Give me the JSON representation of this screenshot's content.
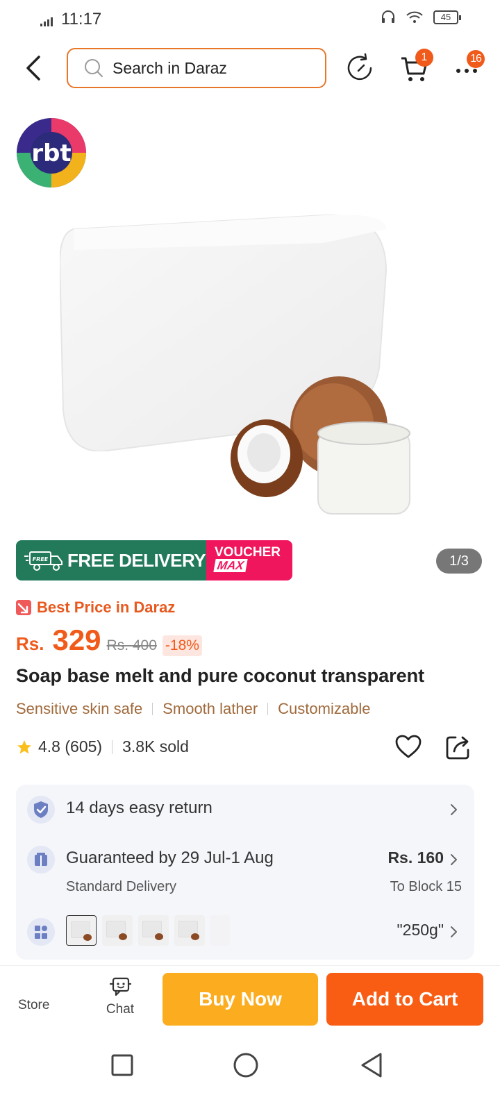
{
  "status_bar": {
    "time": "11:17",
    "battery": "45"
  },
  "header": {
    "search_placeholder": "Search in Daraz",
    "cart_badge": "1",
    "more_badge": "16"
  },
  "gallery": {
    "page_indicator": "1/3",
    "promo_free_delivery": "FREE DELIVERY",
    "promo_free_tag": "FREE",
    "promo_voucher_line1": "VOUCHER",
    "promo_voucher_line2": "MAX"
  },
  "product": {
    "best_price_label": "Best Price in Daraz",
    "currency": "Rs.",
    "price": "329",
    "old_price": "Rs. 400",
    "discount": "-18%",
    "title": "Soap base melt and pure coconut transparent",
    "features": [
      "Sensitive skin safe",
      "Smooth lather",
      "Customizable"
    ],
    "rating": "4.8 (605)",
    "sold": "3.8K sold"
  },
  "info": {
    "return_text": "14 days easy return",
    "delivery_text": "Guaranteed by 29 Jul-1 Aug",
    "delivery_sub": "Standard Delivery",
    "delivery_price": "Rs. 160",
    "delivery_dest": "To Block 15",
    "variant_value": "\"250g\""
  },
  "bottom_bar": {
    "store_label": "Store",
    "chat_label": "Chat",
    "buy_now_label": "Buy Now",
    "add_to_cart_label": "Add to Cart"
  },
  "colors": {
    "accent_orange": "#f95d14",
    "buy_now_yellow": "#fcad1f",
    "promo_green": "#227a5b",
    "promo_pink": "#f0165d"
  }
}
